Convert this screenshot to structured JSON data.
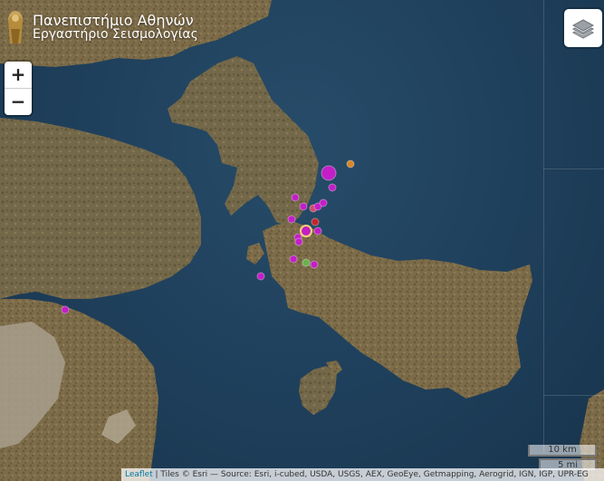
{
  "logo": {
    "line1": "Πανεπιστήμιο Αθηνών",
    "line2": "Εργαστήριο Σεισμολογίας",
    "icon": "university-seal-icon"
  },
  "zoom": {
    "in_label": "+",
    "out_label": "−"
  },
  "layers": {
    "icon": "layers-icon"
  },
  "scale": {
    "km_label": "10 km",
    "mi_label": "5 mi"
  },
  "attribution": {
    "link": "Leaflet",
    "separator": " | ",
    "text": "Tiles © Esri — Source: Esri, i-cubed, USDA, USGS, AEX, GeoEye, Getmapping, Aerogrid, IGN, IGP, UPR-EG"
  },
  "colors": {
    "sea": "#1f405c",
    "land": "#7a6a48",
    "quake_magenta": "#c21fc6",
    "quake_orange": "#d8862a",
    "quake_red": "#c2262b",
    "quake_green": "#6ab04c"
  }
}
